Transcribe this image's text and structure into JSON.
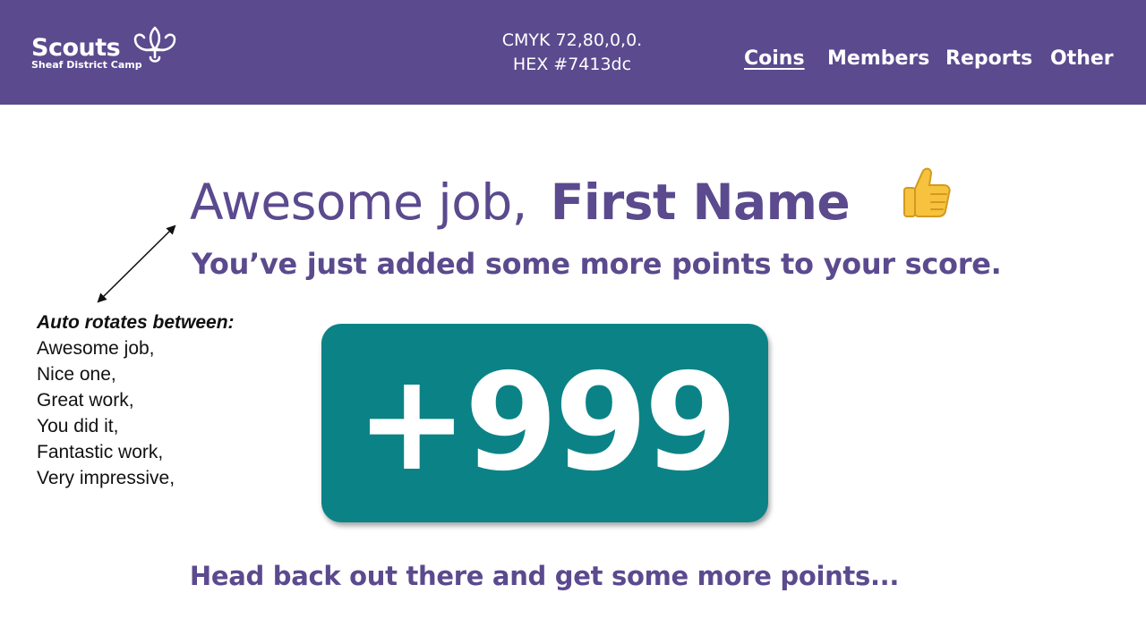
{
  "brand": {
    "name": "Scouts",
    "subtitle": "Sheaf District Camp"
  },
  "color_info": {
    "cmyk": "CMYK 72,80,0,0.",
    "hex": "HEX #7413dc"
  },
  "nav": {
    "items": [
      {
        "label": "Coins",
        "active": true
      },
      {
        "label": "Members",
        "active": false
      },
      {
        "label": "Reports",
        "active": false
      },
      {
        "label": "Other",
        "active": false
      }
    ]
  },
  "main": {
    "greeting": "Awesome job,",
    "name": "First Name",
    "subline": "You’ve just added some more points to your score.",
    "score": "+999",
    "footer": "Head back out there and get some more points..."
  },
  "note": {
    "title": "Auto rotates between:",
    "items": [
      "Awesome job,",
      "Nice one,",
      "Great work,",
      "You did it,",
      "Fantastic work,",
      "Very impressive,"
    ]
  },
  "icons": {
    "logo": "fleur-de-lis-icon",
    "emoji": "thumbs-up-icon",
    "annotation": "double-arrow-icon"
  },
  "colors": {
    "header_bg": "#5b4a8e",
    "accent_text": "#5b4a8e",
    "score_bg": "#0b8386",
    "thumb": "#f7c23e"
  }
}
